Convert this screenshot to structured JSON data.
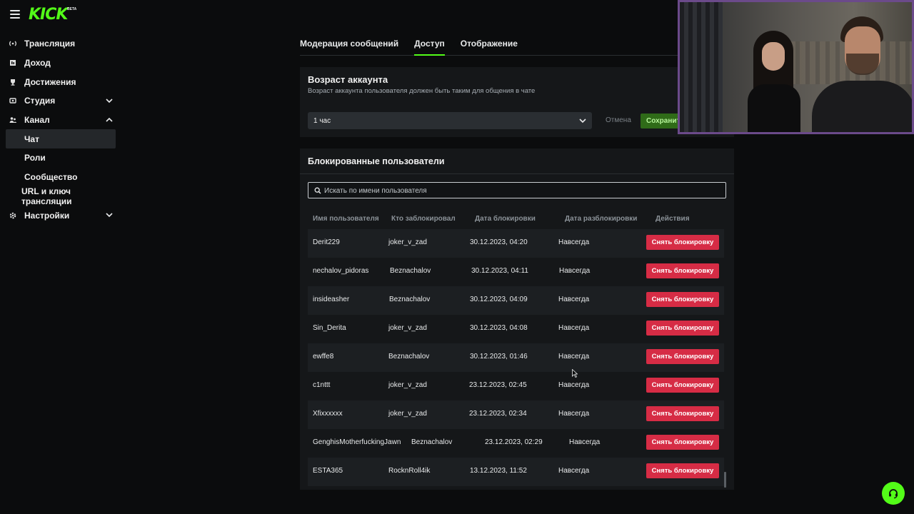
{
  "brand": {
    "logo_text": "KICK",
    "beta_label": "BETA",
    "accent": "#53fc18"
  },
  "sidebar": {
    "items": [
      {
        "label": "Трансляция",
        "icon": "broadcast-icon"
      },
      {
        "label": "Доход",
        "icon": "wallet-icon"
      },
      {
        "label": "Достижения",
        "icon": "trophy-icon"
      },
      {
        "label": "Студия",
        "icon": "studio-icon",
        "expandable": true,
        "expanded": false
      },
      {
        "label": "Канал",
        "icon": "users-icon",
        "expandable": true,
        "expanded": true
      },
      {
        "label": "Настройки",
        "icon": "gear-icon",
        "expandable": true,
        "expanded": false
      }
    ],
    "channel_sub": [
      {
        "label": "Чат",
        "active": true
      },
      {
        "label": "Роли"
      },
      {
        "label": "Сообщество"
      },
      {
        "label": "URL и ключ трансляции"
      }
    ]
  },
  "tabs": [
    {
      "label": "Модерация сообщений",
      "active": false
    },
    {
      "label": "Доступ",
      "active": true
    },
    {
      "label": "Отображение",
      "active": false
    }
  ],
  "account_age": {
    "title": "Возраст аккаунта",
    "description": "Возраст аккаунта пользователя должен быть таким для общения в чате",
    "selected": "1 час",
    "cancel_label": "Отмена",
    "save_label": "Сохранить"
  },
  "blocked": {
    "title": "Блокированные пользователи",
    "search_placeholder": "Искать по имени пользователя",
    "columns": [
      "Имя пользователя",
      "Кто заблокировал",
      "Дата блокировки",
      "Дата разблокировки",
      "Действия"
    ],
    "action_label": "Снять блокировку",
    "rows": [
      {
        "user": "Derit229",
        "by": "joker_v_zad",
        "date": "30.12.2023, 04:20",
        "until": "Навсегда"
      },
      {
        "user": "nechalov_pidoras",
        "by": "Beznachalov",
        "date": "30.12.2023, 04:11",
        "until": "Навсегда"
      },
      {
        "user": "insideasher",
        "by": "Beznachalov",
        "date": "30.12.2023, 04:09",
        "until": "Навсегда"
      },
      {
        "user": "Sin_Derita",
        "by": "joker_v_zad",
        "date": "30.12.2023, 04:08",
        "until": "Навсегда"
      },
      {
        "user": "ewffe8",
        "by": "Beznachalov",
        "date": "30.12.2023, 01:46",
        "until": "Навсегда"
      },
      {
        "user": "c1nttt",
        "by": "joker_v_zad",
        "date": "23.12.2023, 02:45",
        "until": "Навсегда"
      },
      {
        "user": "Xfixxxxxx",
        "by": "joker_v_zad",
        "date": "23.12.2023, 02:34",
        "until": "Навсегда"
      },
      {
        "user": "GenghisMotherfuckingJawn",
        "by": "Beznachalov",
        "date": "23.12.2023, 02:29",
        "until": "Навсегда"
      },
      {
        "user": "ESTA365",
        "by": "RocknRoll4ik",
        "date": "13.12.2023, 11:52",
        "until": "Навсегда"
      }
    ]
  }
}
